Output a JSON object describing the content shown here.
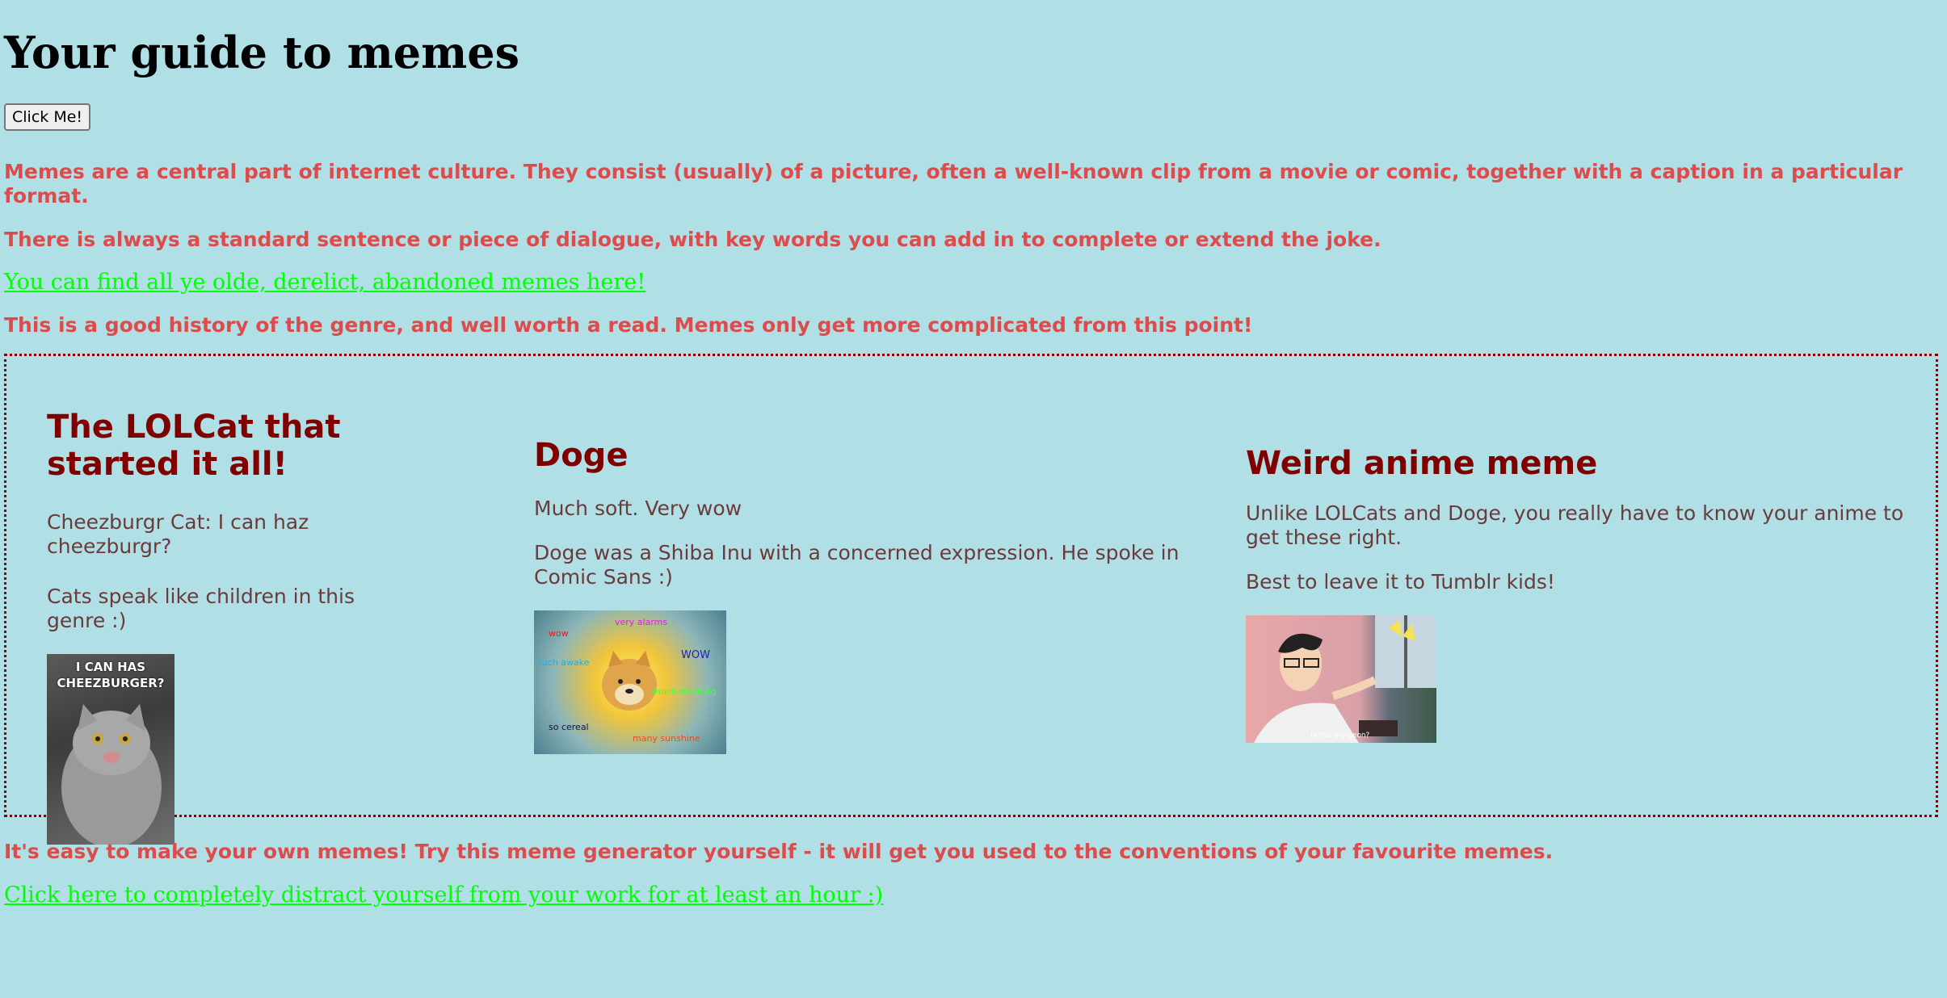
{
  "title": "Your guide to memes",
  "button_label": "Click Me!",
  "intro": [
    "Memes are a central part of internet culture. They consist (usually) of a picture, often a well-known clip from a movie or comic, together with a caption in a particular format.",
    "There is always a standard sentence or piece of dialogue, with key words you can add in to complete or extend the joke."
  ],
  "history_link": "You can find all ye olde, derelict, abandoned memes here!",
  "history_note": "This is a good history of the genre, and well worth a read. Memes only get more complicated from this point!",
  "memes": [
    {
      "heading": "The LOLCat that started it all!",
      "lines": [
        "Cheezburgr Cat: I can haz cheezburgr?",
        "Cats speak like children in this genre :)"
      ],
      "image_caption": "I CAN HAS CHEEZBURGER?"
    },
    {
      "heading": "Doge",
      "lines": [
        "Much soft. Very wow",
        "Doge was a Shiba Inu with a concerned expression. He spoke in Comic Sans :)"
      ],
      "image_words": [
        "wow",
        "very alarms",
        "such awake",
        "WOW",
        "much morning",
        "so cereal",
        "many sunshine"
      ]
    },
    {
      "heading": "Weird anime meme",
      "lines": [
        "Unlike LOLCats and Doge, you really have to know your anime to get these right.",
        "Best to leave it to Tumblr kids!"
      ],
      "image_caption": "Is this a pigeon?"
    }
  ],
  "generator_text": "It's easy to make your own memes! Try this meme generator yourself - it will get you used to the conventions of your favourite memes.",
  "generator_link": "Click here to completely distract yourself from your work for at least an hour :)"
}
